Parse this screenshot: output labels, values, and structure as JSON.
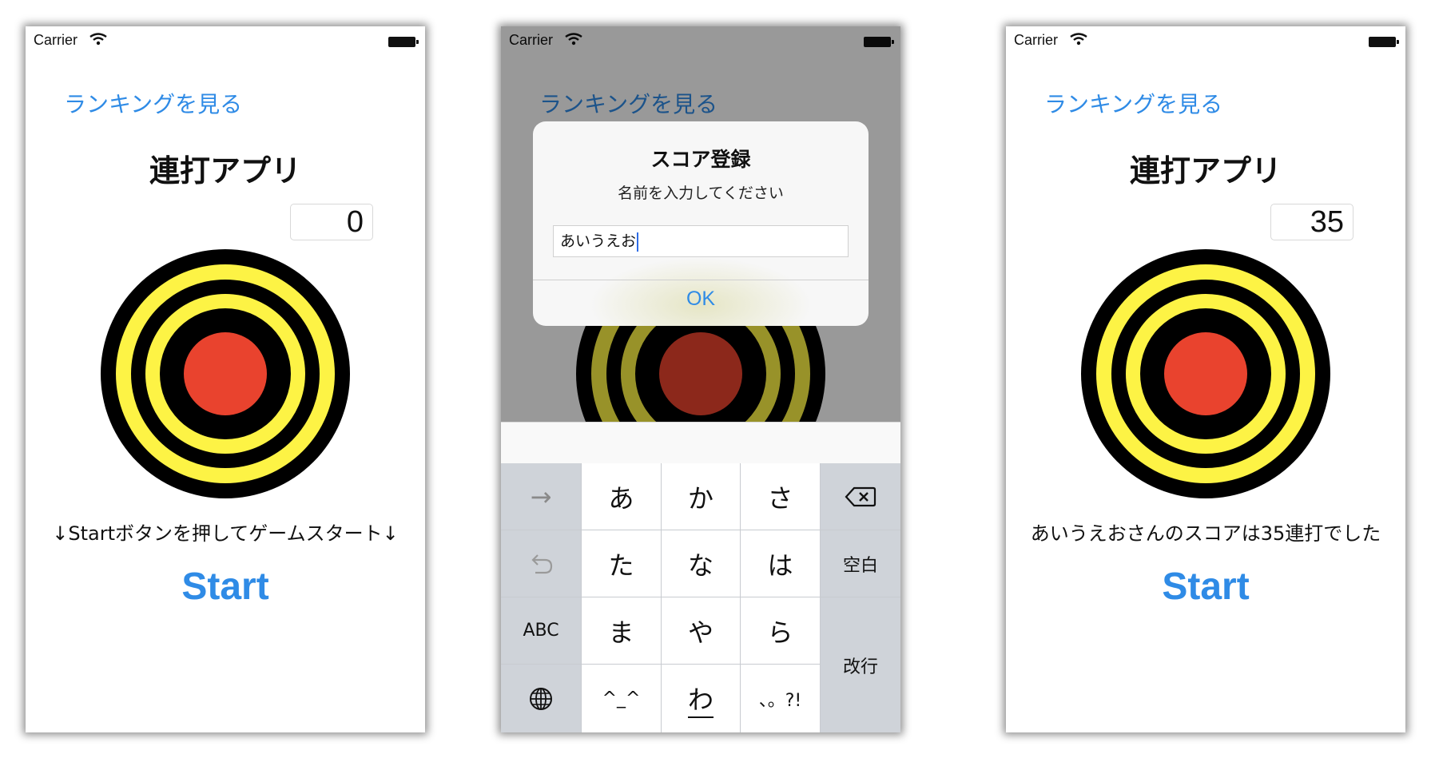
{
  "status_bar": {
    "carrier": "Carrier"
  },
  "colors": {
    "accent": "#2f8be6",
    "target_yellow": "#fdf345",
    "target_red": "#e9432e",
    "ring_black": "#000000"
  },
  "screen_start": {
    "ranking_link": "ランキングを見る",
    "title": "連打アプリ",
    "score": "0",
    "message": "↓Startボタンを押してゲームスタート↓",
    "start_button": "Start"
  },
  "screen_register": {
    "ranking_link": "ランキングを見る",
    "alert": {
      "title": "スコア登録",
      "message": "名前を入力してください",
      "input_value": "あいうえお",
      "ok_button": "OK"
    },
    "keyboard": {
      "rows": [
        [
          "→",
          "あ",
          "か",
          "さ",
          "delete-icon"
        ],
        [
          "undo-icon",
          "た",
          "な",
          "は",
          "空白"
        ],
        [
          "ABC",
          "ま",
          "や",
          "ら",
          "改行"
        ],
        [
          "globe-icon",
          "^_^",
          "わ",
          "、。?!"
        ]
      ]
    }
  },
  "screen_result": {
    "ranking_link": "ランキングを見る",
    "title": "連打アプリ",
    "score": "35",
    "message": "あいうえおさんのスコアは35連打でした",
    "start_button": "Start"
  }
}
